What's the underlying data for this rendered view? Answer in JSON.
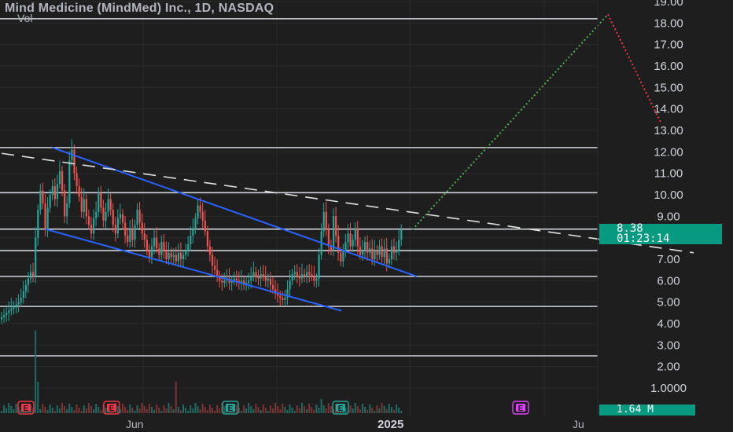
{
  "header": {
    "title": "Mind Medicine (MindMed) Inc., 1D, NASDAQ",
    "volume_label": "Vol"
  },
  "price_tag": {
    "price": "8.38",
    "countdown": "01:23:14"
  },
  "volume_tag": "1.64 M",
  "colors": {
    "background": "#1e1e1e",
    "grid": "#2b2b2b",
    "up": "#26a69a",
    "down": "#ef5350",
    "channel": "#2962ff",
    "level": "#d1d4dc",
    "projection_up": "#4caf50",
    "projection_down": "#f23645",
    "earnings_red": "#f23645",
    "earnings_green": "#26a69a",
    "earnings_future": "#e040fb"
  },
  "earnings_markers": [
    {
      "label": "E",
      "color": "red"
    },
    {
      "label": "E",
      "color": "red"
    },
    {
      "label": "E",
      "color": "green"
    },
    {
      "label": "E",
      "color": "green"
    },
    {
      "label": "E",
      "color": "magenta"
    }
  ],
  "chart_data": {
    "type": "candlestick",
    "title": "Mind Medicine (MindMed) Inc., 1D, NASDAQ",
    "price_axis": {
      "ticks": [
        "1.0000",
        "2.00",
        "3.00",
        "4.00",
        "5.00",
        "6.00",
        "7.00",
        "8.00",
        "9.00",
        "10.00",
        "11.00",
        "12.00",
        "13.00",
        "14.00",
        "15.00",
        "16.00",
        "17.00",
        "18.00",
        "19.00"
      ],
      "range": [
        1.0,
        19.0
      ]
    },
    "time_axis": {
      "ticks": [
        "Jun",
        "2025",
        "Ju"
      ]
    },
    "last_price": 8.38,
    "horizontal_levels": [
      18.2,
      12.2,
      10.1,
      8.4,
      7.4,
      6.2,
      4.8,
      2.5
    ],
    "descending_channel": {
      "upper": [
        {
          "t": "2024-04-09",
          "p": 12.2
        },
        {
          "t": "2025-01-06",
          "p": 6.2
        }
      ],
      "lower": [
        {
          "t": "2024-04-04",
          "p": 8.4
        },
        {
          "t": "2024-11-11",
          "p": 4.6
        }
      ]
    },
    "dashed_trendline": [
      {
        "t": "2024-02-01",
        "p": 12.2
      },
      {
        "t": "2025-08-01",
        "p": 7.3
      }
    ],
    "projection_up": [
      {
        "t": "2025-01-03",
        "p": 8.38
      },
      {
        "t": "2025-05-29",
        "p": 18.4
      }
    ],
    "projection_down": [
      {
        "t": "2025-05-29",
        "p": 18.4
      },
      {
        "t": "2025-07-08",
        "p": 13.3
      }
    ],
    "candles_close": [
      4.3,
      4.4,
      4.5,
      4.6,
      4.7,
      4.8,
      4.9,
      5.0,
      5.2,
      5.5,
      5.8,
      6.1,
      6.4,
      6.2,
      8.0,
      9.3,
      10.2,
      9.6,
      8.4,
      9.4,
      10.0,
      10.4,
      9.8,
      10.5,
      11.1,
      10.2,
      9.0,
      9.6,
      11.6,
      12.1,
      11.0,
      10.4,
      9.9,
      9.2,
      9.8,
      9.0,
      8.6,
      8.2,
      8.9,
      9.2,
      10.1,
      9.4,
      8.8,
      9.2,
      9.8,
      9.3,
      8.6,
      8.2,
      8.9,
      9.1,
      8.7,
      8.1,
      7.8,
      8.4,
      7.9,
      8.6,
      9.3,
      8.7,
      8.2,
      7.9,
      7.4,
      7.1,
      7.6,
      8.0,
      7.5,
      7.2,
      7.8,
      7.4,
      7.0,
      7.3,
      7.1,
      7.2,
      6.9,
      7.3,
      7.0,
      7.2,
      7.4,
      7.7,
      8.1,
      8.4,
      8.9,
      9.5,
      9.2,
      8.8,
      8.3,
      7.6,
      7.2,
      6.7,
      6.5,
      6.2,
      6.0,
      5.9,
      6.0,
      6.1,
      5.9,
      6.0,
      6.1,
      6.0,
      5.9,
      6.0,
      5.8,
      5.9,
      6.0,
      6.2,
      6.4,
      6.2,
      6.1,
      6.3,
      6.2,
      6.0,
      6.1,
      5.8,
      5.6,
      5.4,
      5.3,
      5.2,
      5.1,
      5.2,
      5.6,
      6.0,
      6.3,
      6.4,
      6.2,
      6.1,
      6.3,
      6.2,
      6.4,
      6.3,
      6.2,
      6.0,
      6.1,
      7.2,
      8.3,
      9.2,
      8.4,
      7.6,
      7.4,
      9.0,
      8.1,
      7.3,
      6.9,
      7.4,
      7.8,
      8.2,
      7.6,
      7.9,
      8.4,
      7.6,
      7.2,
      7.4,
      7.8,
      7.3,
      7.5,
      7.0,
      7.4,
      7.2,
      7.6,
      7.1,
      7.5,
      6.8,
      7.0,
      7.6,
      7.3,
      7.4,
      7.9,
      8.38
    ],
    "volume_peak": "1.64 M"
  }
}
